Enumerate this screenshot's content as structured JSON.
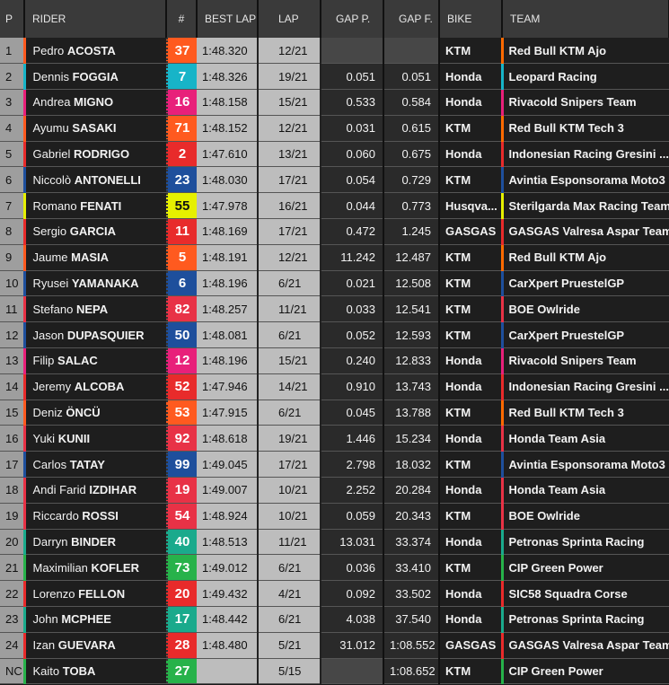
{
  "headers": {
    "p": "P",
    "rider": "RIDER",
    "num": "#",
    "best": "BEST LAP",
    "lap": "LAP",
    "gap_p": "GAP P.",
    "gap_f": "GAP F.",
    "bike": "BIKE",
    "team": "TEAM"
  },
  "rows": [
    {
      "p": "1",
      "first": "Pedro",
      "last": "ACOSTA",
      "num": "37",
      "color": "#ff5a1f",
      "best": "1:48.320",
      "lap": "12/21",
      "gap_p": "",
      "gap_f": "",
      "bike": "KTM",
      "team": "Red Bull KTM Ajo",
      "tc": "#ff6a00"
    },
    {
      "p": "2",
      "first": "Dennis",
      "last": "FOGGIA",
      "num": "7",
      "color": "#17b4c8",
      "best": "1:48.326",
      "lap": "19/21",
      "gap_p": "0.051",
      "gap_f": "0.051",
      "bike": "Honda",
      "team": "Leopard Racing",
      "tc": "#17b4c8"
    },
    {
      "p": "3",
      "first": "Andrea",
      "last": "MIGNO",
      "num": "16",
      "color": "#e8207a",
      "best": "1:48.158",
      "lap": "15/21",
      "gap_p": "0.533",
      "gap_f": "0.584",
      "bike": "Honda",
      "team": "Rivacold Snipers Team",
      "tc": "#e8207a"
    },
    {
      "p": "4",
      "first": "Ayumu",
      "last": "SASAKI",
      "num": "71",
      "color": "#ff5a1f",
      "best": "1:48.152",
      "lap": "12/21",
      "gap_p": "0.031",
      "gap_f": "0.615",
      "bike": "KTM",
      "team": "Red Bull KTM Tech 3",
      "tc": "#ff6a00"
    },
    {
      "p": "5",
      "first": "Gabriel",
      "last": "RODRIGO",
      "num": "2",
      "color": "#e82b2b",
      "best": "1:47.610",
      "lap": "13/21",
      "gap_p": "0.060",
      "gap_f": "0.675",
      "bike": "Honda",
      "team": "Indonesian Racing Gresini ...",
      "tc": "#e82b2b"
    },
    {
      "p": "6",
      "first": "Niccolò",
      "last": "ANTONELLI",
      "num": "23",
      "color": "#1e4f9c",
      "best": "1:48.030",
      "lap": "17/21",
      "gap_p": "0.054",
      "gap_f": "0.729",
      "bike": "KTM",
      "team": "Avintia Esponsorama Moto3",
      "tc": "#1e4f9c"
    },
    {
      "p": "7",
      "first": "Romano",
      "last": "FENATI",
      "num": "55",
      "color": "#e6f000",
      "best": "1:47.978",
      "lap": "16/21",
      "gap_p": "0.044",
      "gap_f": "0.773",
      "bike": "Husqva...",
      "team": "Sterilgarda Max Racing Team",
      "tc": "#e6f000"
    },
    {
      "p": "8",
      "first": "Sergio",
      "last": "GARCIA",
      "num": "11",
      "color": "#e82b2b",
      "best": "1:48.169",
      "lap": "17/21",
      "gap_p": "0.472",
      "gap_f": "1.245",
      "bike": "GASGAS",
      "team": "GASGAS Valresa Aspar Team",
      "tc": "#e82b2b"
    },
    {
      "p": "9",
      "first": "Jaume",
      "last": "MASIA",
      "num": "5",
      "color": "#ff5a1f",
      "best": "1:48.191",
      "lap": "12/21",
      "gap_p": "11.242",
      "gap_f": "12.487",
      "bike": "KTM",
      "team": "Red Bull KTM Ajo",
      "tc": "#ff6a00"
    },
    {
      "p": "10",
      "first": "Ryusei",
      "last": "YAMANAKA",
      "num": "6",
      "color": "#1e4f9c",
      "best": "1:48.196",
      "lap": "6/21",
      "gap_p": "0.021",
      "gap_f": "12.508",
      "bike": "KTM",
      "team": "CarXpert PruestelGP",
      "tc": "#1e4f9c"
    },
    {
      "p": "11",
      "first": "Stefano",
      "last": "NEPA",
      "num": "82",
      "color": "#e83246",
      "best": "1:48.257",
      "lap": "11/21",
      "gap_p": "0.033",
      "gap_f": "12.541",
      "bike": "KTM",
      "team": "BOE Owlride",
      "tc": "#e83246"
    },
    {
      "p": "12",
      "first": "Jason",
      "last": "DUPASQUIER",
      "num": "50",
      "color": "#1e4f9c",
      "best": "1:48.081",
      "lap": "6/21",
      "gap_p": "0.052",
      "gap_f": "12.593",
      "bike": "KTM",
      "team": "CarXpert PruestelGP",
      "tc": "#1e4f9c"
    },
    {
      "p": "13",
      "first": "Filip",
      "last": "SALAC",
      "num": "12",
      "color": "#e8207a",
      "best": "1:48.196",
      "lap": "15/21",
      "gap_p": "0.240",
      "gap_f": "12.833",
      "bike": "Honda",
      "team": "Rivacold Snipers Team",
      "tc": "#e8207a"
    },
    {
      "p": "14",
      "first": "Jeremy",
      "last": "ALCOBA",
      "num": "52",
      "color": "#e82b2b",
      "best": "1:47.946",
      "lap": "14/21",
      "gap_p": "0.910",
      "gap_f": "13.743",
      "bike": "Honda",
      "team": "Indonesian Racing Gresini ...",
      "tc": "#e82b2b"
    },
    {
      "p": "15",
      "first": "Deniz",
      "last": "ÖNCÜ",
      "num": "53",
      "color": "#ff5a1f",
      "best": "1:47.915",
      "lap": "6/21",
      "gap_p": "0.045",
      "gap_f": "13.788",
      "bike": "KTM",
      "team": "Red Bull KTM Tech 3",
      "tc": "#ff6a00"
    },
    {
      "p": "16",
      "first": "Yuki",
      "last": "KUNII",
      "num": "92",
      "color": "#e83246",
      "best": "1:48.618",
      "lap": "19/21",
      "gap_p": "1.446",
      "gap_f": "15.234",
      "bike": "Honda",
      "team": "Honda Team Asia",
      "tc": "#e83246"
    },
    {
      "p": "17",
      "first": "Carlos",
      "last": "TATAY",
      "num": "99",
      "color": "#1e4f9c",
      "best": "1:49.045",
      "lap": "17/21",
      "gap_p": "2.798",
      "gap_f": "18.032",
      "bike": "KTM",
      "team": "Avintia Esponsorama Moto3",
      "tc": "#1e4f9c"
    },
    {
      "p": "18",
      "first": "Andi Farid",
      "last": "IZDIHAR",
      "num": "19",
      "color": "#e83246",
      "best": "1:49.007",
      "lap": "10/21",
      "gap_p": "2.252",
      "gap_f": "20.284",
      "bike": "Honda",
      "team": "Honda Team Asia",
      "tc": "#e83246"
    },
    {
      "p": "19",
      "first": "Riccardo",
      "last": "ROSSI",
      "num": "54",
      "color": "#e83246",
      "best": "1:48.924",
      "lap": "10/21",
      "gap_p": "0.059",
      "gap_f": "20.343",
      "bike": "KTM",
      "team": "BOE Owlride",
      "tc": "#e83246"
    },
    {
      "p": "20",
      "first": "Darryn",
      "last": "BINDER",
      "num": "40",
      "color": "#1aaa8c",
      "best": "1:48.513",
      "lap": "11/21",
      "gap_p": "13.031",
      "gap_f": "33.374",
      "bike": "Honda",
      "team": "Petronas Sprinta Racing",
      "tc": "#1aaa8c"
    },
    {
      "p": "21",
      "first": "Maximilian",
      "last": "KOFLER",
      "num": "73",
      "color": "#27b24a",
      "best": "1:49.012",
      "lap": "6/21",
      "gap_p": "0.036",
      "gap_f": "33.410",
      "bike": "KTM",
      "team": "CIP Green Power",
      "tc": "#27b24a"
    },
    {
      "p": "22",
      "first": "Lorenzo",
      "last": "FELLON",
      "num": "20",
      "color": "#e82b2b",
      "best": "1:49.432",
      "lap": "4/21",
      "gap_p": "0.092",
      "gap_f": "33.502",
      "bike": "Honda",
      "team": "SIC58 Squadra Corse",
      "tc": "#e82b2b"
    },
    {
      "p": "23",
      "first": "John",
      "last": "MCPHEE",
      "num": "17",
      "color": "#1aaa8c",
      "best": "1:48.442",
      "lap": "6/21",
      "gap_p": "4.038",
      "gap_f": "37.540",
      "bike": "Honda",
      "team": "Petronas Sprinta Racing",
      "tc": "#1aaa8c"
    },
    {
      "p": "24",
      "first": "Izan",
      "last": "GUEVARA",
      "num": "28",
      "color": "#e82b2b",
      "best": "1:48.480",
      "lap": "5/21",
      "gap_p": "31.012",
      "gap_f": "1:08.552",
      "bike": "GASGAS",
      "team": "GASGAS Valresa Aspar Team",
      "tc": "#e82b2b"
    },
    {
      "p": "NC",
      "first": "Kaito",
      "last": "TOBA",
      "num": "27",
      "color": "#27b24a",
      "best": "",
      "lap": "5/15",
      "gap_p": "",
      "gap_f": "1:08.652",
      "bike": "KTM",
      "team": "CIP Green Power",
      "tc": "#27b24a"
    }
  ]
}
